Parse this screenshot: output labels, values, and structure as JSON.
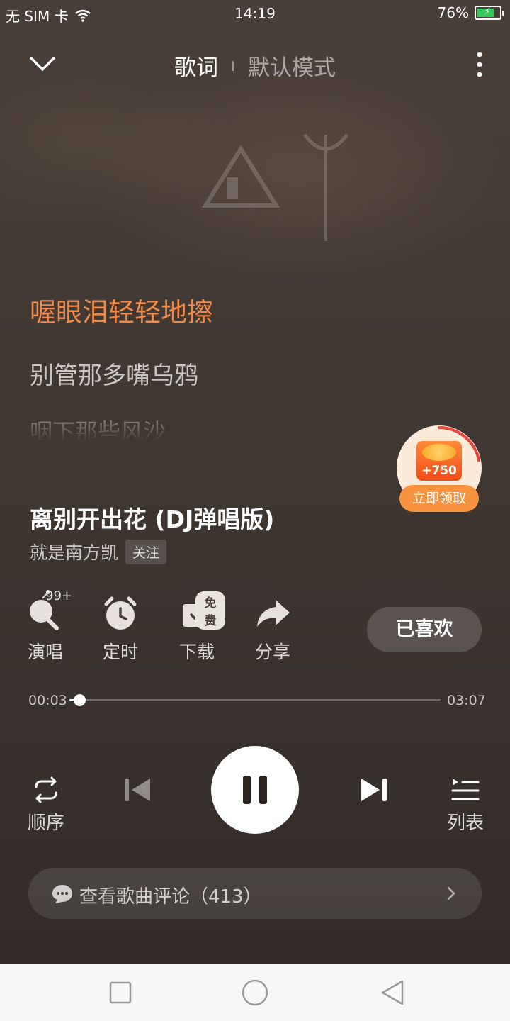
{
  "status_bar": {
    "carrier": "无 SIM 卡",
    "time": "14:19",
    "battery_percent": "76%",
    "battery_level": 0.76,
    "charging": true
  },
  "header": {
    "tabs": [
      {
        "label": "歌词",
        "active": true
      },
      {
        "label": "默认模式",
        "active": false
      }
    ]
  },
  "lyrics": {
    "current": "喔眼泪轻轻地擦",
    "next": "别管那多嘴乌鸦",
    "following": "咽下那些风沙"
  },
  "reward": {
    "amount": "+750",
    "button": "立即领取",
    "progress": 0.22
  },
  "song": {
    "title": "离别开出花 (DJ弹唱版)",
    "artist": "就是南方凯",
    "follow_label": "关注"
  },
  "actions": {
    "sing": {
      "label": "演唱",
      "badge": "99+"
    },
    "timer": {
      "label": "定时"
    },
    "download": {
      "label": "下载",
      "badge": "免费"
    },
    "share": {
      "label": "分享"
    },
    "liked": {
      "label": "已喜欢"
    }
  },
  "progress": {
    "elapsed": "00:03",
    "total": "03:07",
    "fraction": 0.027
  },
  "controls": {
    "mode_label": "顺序",
    "list_label": "列表",
    "state": "playing"
  },
  "comments": {
    "label": "查看歌曲评论（413）"
  },
  "colors": {
    "accent": "#f08a4b",
    "reward_button": "#f7933f",
    "background": "#3f3733",
    "battery_fill": "#35c759"
  }
}
